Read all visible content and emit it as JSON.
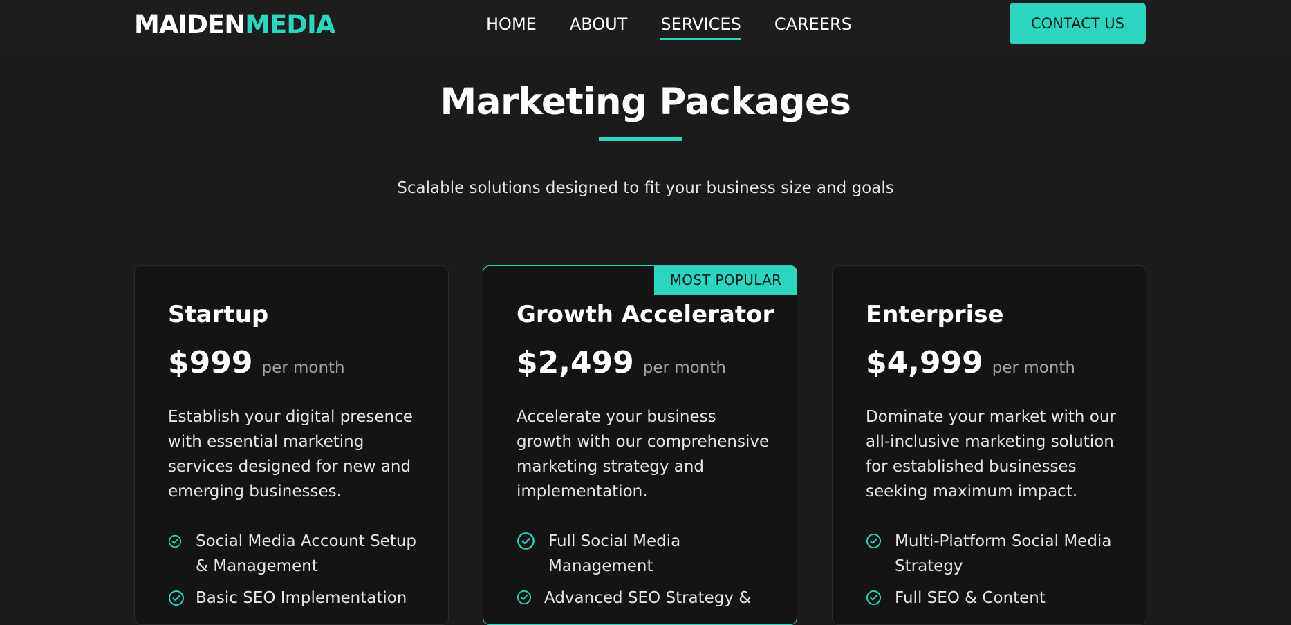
{
  "brand": {
    "part1": "MAIDEN",
    "part2": "MEDIA",
    "accent": "#2dd4bf"
  },
  "nav": {
    "items": [
      {
        "label": "HOME",
        "active": false
      },
      {
        "label": "ABOUT",
        "active": false
      },
      {
        "label": "SERVICES",
        "active": true
      },
      {
        "label": "CAREERS",
        "active": false
      }
    ],
    "cta": "CONTACT US"
  },
  "section": {
    "title": "Marketing Packages",
    "subtitle": "Scalable solutions designed to fit your business size and goals"
  },
  "cards": [
    {
      "name": "Startup",
      "price": "$999",
      "period": "per month",
      "description": "Establish your digital presence with essential marketing services designed for new and emerging businesses.",
      "features": [
        "Social Media Account Setup & Management",
        "Basic SEO Implementation"
      ]
    },
    {
      "name": "Growth Accelerator",
      "badge": "MOST POPULAR",
      "price": "$2,499",
      "period": "per month",
      "description": "Accelerate your business growth with our comprehensive marketing strategy and implementation.",
      "features": [
        "Full Social Media Management",
        "Advanced SEO Strategy &"
      ]
    },
    {
      "name": "Enterprise",
      "price": "$4,999",
      "period": "per month",
      "description": "Dominate your market with our all-inclusive marketing solution for established businesses seeking maximum impact.",
      "features": [
        "Multi-Platform Social Media Strategy",
        "Full SEO & Content"
      ]
    }
  ],
  "icons": {
    "feature": "check-circle-icon"
  }
}
